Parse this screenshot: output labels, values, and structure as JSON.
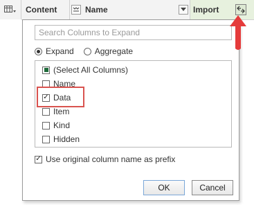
{
  "header": {
    "content_label": "Content",
    "name_label": "Name",
    "import_label": "Import",
    "icons": [
      "table-icon",
      "expand-icon",
      "filter-dropdown-icon",
      "expand-columns-icon"
    ]
  },
  "popup": {
    "search_placeholder": "Search Columns to Expand",
    "mode": {
      "expand_label": "Expand",
      "aggregate_label": "Aggregate",
      "selected": "Expand"
    },
    "columns": [
      {
        "label": "(Select All Columns)",
        "state": "partial"
      },
      {
        "label": "Name",
        "state": "unchecked"
      },
      {
        "label": "Data",
        "state": "checked"
      },
      {
        "label": "Item",
        "state": "unchecked"
      },
      {
        "label": "Kind",
        "state": "unchecked"
      },
      {
        "label": "Hidden",
        "state": "unchecked"
      }
    ],
    "prefix_label": "Use original column name as prefix",
    "prefix_checked": true,
    "ok_label": "OK",
    "cancel_label": "Cancel"
  },
  "colors": {
    "highlight_box": "#d9534f",
    "arrow": "#e53b3b",
    "import_header_bg": "#e7f1de"
  }
}
